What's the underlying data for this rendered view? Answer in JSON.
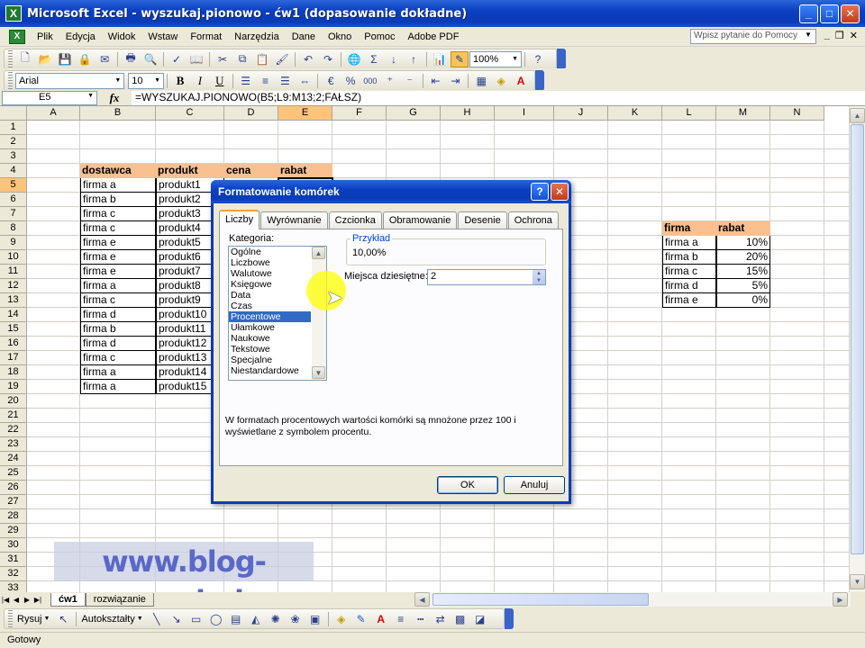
{
  "window": {
    "title": "Microsoft Excel - wyszukaj.pionowo - ćw1 (dopasowanie dokładne)",
    "minimize": "_",
    "maximize": "□",
    "close": "✕"
  },
  "menu": {
    "items": [
      "Plik",
      "Edycja",
      "Widok",
      "Wstaw",
      "Format",
      "Narzędzia",
      "Dane",
      "Okno",
      "Pomoc",
      "Adobe PDF"
    ],
    "help_placeholder": "Wpisz pytanie do Pomocy"
  },
  "toolbar": {
    "zoom": "100%",
    "font_name": "Arial",
    "font_size": "10",
    "bold": "B",
    "italic": "I",
    "underline": "U",
    "euro": "€",
    "percent": "%",
    "thousands": "000",
    "sum": "Σ"
  },
  "formula_bar": {
    "cell_ref": "E5",
    "fx": "fx",
    "formula": "=WYSZUKAJ.PIONOWO(B5;L9:M13;2;FAŁSZ)"
  },
  "grid": {
    "columns": [
      "A",
      "B",
      "C",
      "D",
      "E",
      "F",
      "G",
      "H",
      "I",
      "J",
      "K",
      "L",
      "M",
      "N"
    ],
    "selected_column": "E",
    "selected_row": 5,
    "rows": [
      1,
      2,
      3,
      4,
      5,
      6,
      7,
      8,
      9,
      10,
      11,
      12,
      13,
      14,
      15,
      16,
      17,
      18,
      19,
      20,
      21,
      22,
      23,
      24,
      25,
      26,
      27,
      28,
      29,
      30,
      31,
      32,
      33
    ],
    "main_table": {
      "headers": [
        "dostawca",
        "produkt",
        "cena",
        "rabat"
      ],
      "rows": [
        [
          "firma a",
          "produkt1"
        ],
        [
          "firma b",
          "produkt2"
        ],
        [
          "firma c",
          "produkt3"
        ],
        [
          "firma c",
          "produkt4"
        ],
        [
          "firma e",
          "produkt5"
        ],
        [
          "firma e",
          "produkt6"
        ],
        [
          "firma e",
          "produkt7"
        ],
        [
          "firma a",
          "produkt8"
        ],
        [
          "firma c",
          "produkt9"
        ],
        [
          "firma d",
          "produkt10"
        ],
        [
          "firma b",
          "produkt11"
        ],
        [
          "firma d",
          "produkt12"
        ],
        [
          "firma c",
          "produkt13"
        ],
        [
          "firma a",
          "produkt14"
        ],
        [
          "firma a",
          "produkt15"
        ]
      ]
    },
    "lookup_table": {
      "headers": [
        "firma",
        "rabat"
      ],
      "rows": [
        [
          "firma a",
          "10%"
        ],
        [
          "firma b",
          "20%"
        ],
        [
          "firma c",
          "15%"
        ],
        [
          "firma d",
          "5%"
        ],
        [
          "firma e",
          "0%"
        ]
      ]
    }
  },
  "watermark": "www.blog-excel.pl",
  "sheets": {
    "tabs": [
      "ćw1",
      "rozwiązanie"
    ],
    "active": "ćw1"
  },
  "draw_toolbar": {
    "draw": "Rysuj",
    "autoshapes": "Autokształty"
  },
  "status": "Gotowy",
  "dialog": {
    "title": "Formatowanie komórek",
    "tabs": [
      "Liczby",
      "Wyrównanie",
      "Czcionka",
      "Obramowanie",
      "Desenie",
      "Ochrona"
    ],
    "active_tab": "Liczby",
    "category_label": "Kategoria:",
    "categories": [
      "Ogólne",
      "Liczbowe",
      "Walutowe",
      "Księgowe",
      "Data",
      "Czas",
      "Procentowe",
      "Ułamkowe",
      "Naukowe",
      "Tekstowe",
      "Specjalne",
      "Niestandardowe"
    ],
    "selected_category": "Procentowe",
    "sample_label": "Przykład",
    "sample_value": "10,00%",
    "decimal_label": "Miejsca dziesiętne:",
    "decimal_value": "2",
    "description": "W formatach procentowych wartości komórki są mnożone przez 100 i wyświetlane z symbolem procentu.",
    "ok": "OK",
    "cancel": "Anuluj"
  }
}
